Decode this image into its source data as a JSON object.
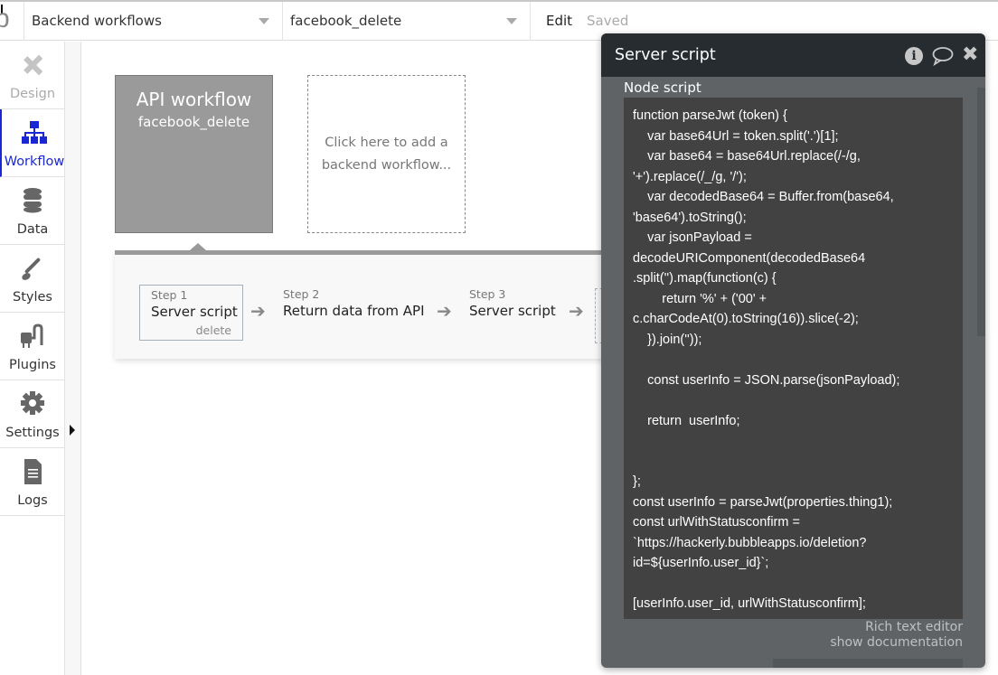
{
  "header": {
    "logo_letter": "b",
    "page_selector": "Backend workflows",
    "workflow_selector": "facebook_delete",
    "edit_label": "Edit",
    "status": "Saved"
  },
  "sidebar": {
    "items": [
      {
        "label": "Design",
        "icon": "design-tools-icon",
        "state": "disabled"
      },
      {
        "label": "Workflow",
        "icon": "workflow-tree-icon",
        "state": "active"
      },
      {
        "label": "Data",
        "icon": "database-icon",
        "state": "normal"
      },
      {
        "label": "Styles",
        "icon": "paintbrush-icon",
        "state": "normal"
      },
      {
        "label": "Plugins",
        "icon": "plug-icon",
        "state": "normal"
      },
      {
        "label": "Settings",
        "icon": "gear-icon",
        "state": "normal"
      },
      {
        "label": "Logs",
        "icon": "document-icon",
        "state": "normal"
      }
    ],
    "accent": "#1a28d4"
  },
  "canvas": {
    "api_card": {
      "title": "API workflow",
      "name": "facebook_delete"
    },
    "add_card": {
      "line1": "Click here to add a",
      "line2": "backend workflow..."
    },
    "steps": [
      {
        "num": "Step 1",
        "name": "Server script",
        "sub": "delete"
      },
      {
        "num": "Step 2",
        "name": "Return data from API"
      },
      {
        "num": "Step 3",
        "name": "Server script"
      }
    ],
    "arrow_glyph": "➔"
  },
  "modal": {
    "title": "Server script",
    "field_label": "Node script",
    "code_lines": [
      "function parseJwt (token) {",
      "    var base64Url = token.split('.')[1];",
      "    var base64 = base64Url.replace(/-/g,",
      "'+').replace(/_/g, '/');",
      "    var decodedBase64 = Buffer.from(base64,",
      "'base64').toString();",
      "    var jsonPayload =",
      "decodeURIComponent(decodedBase64",
      ".split('').map(function(c) {",
      "        return '%' + ('00' +",
      "c.charCodeAt(0).toString(16)).slice(-2);",
      "    }).join(''));",
      "",
      "    const userInfo = JSON.parse(jsonPayload);",
      "",
      "    return  userInfo;",
      "",
      "",
      "};",
      "const userInfo = parseJwt(properties.thing1);",
      "const urlWithStatusconfirm =",
      "`https://hackerly.bubbleapps.io/deletion?",
      "id=${userInfo.user_id}`;",
      "",
      "[userInfo.user_id, urlWithStatusconfirm];"
    ],
    "rich_text_link": "Rich text editor",
    "doc_link": "show documentation"
  }
}
